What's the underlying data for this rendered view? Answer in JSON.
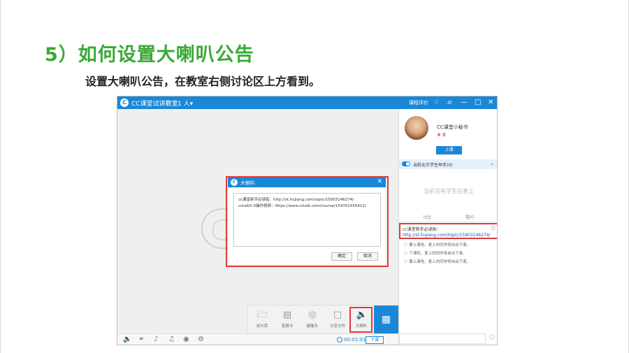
{
  "slide": {
    "title": "5）如何设置大喇叭公告",
    "subtitle": "设置大喇叭公告，在教室右侧讨论区上方看到。"
  },
  "app": {
    "logo": "C",
    "title": "CC课堂试讲教室",
    "people_count": "1 人▾",
    "course_eval": "课程评价",
    "titlebar_icons": [
      "bell-icon",
      "signal-icon",
      "minimize-icon",
      "maximize-icon",
      "close-icon"
    ],
    "user": {
      "name": "CC课堂小秘书",
      "score": "0",
      "stage_button": "上课"
    },
    "allow_hands": "当前允许学生举手(0)",
    "no_students": "当前没有学生在麦上",
    "tabs": [
      "讨论",
      "提问"
    ],
    "notice": {
      "title": "cc课堂新手必读贴：",
      "link": "http://st.hujiang.com/topic/15903146274/"
    },
    "chat_messages": [
      "要上课啦，麦上的同学将自动下麦。",
      "下课啦，麦上的同学将自动下麦。",
      "要上课啦，麦上的同学将自动下麦。"
    ],
    "toolbar": [
      {
        "label": "讲义库",
        "icon": "folder-icon"
      },
      {
        "label": "答题卡",
        "icon": "clipboard-icon"
      },
      {
        "label": "摄像头",
        "icon": "camera-icon"
      },
      {
        "label": "分享文件",
        "icon": "file-icon"
      },
      {
        "label": "大喇叭",
        "icon": "speaker-icon"
      }
    ],
    "bottom_icons": [
      "volume-icon",
      "mic-icon",
      "music-icon",
      "note-icon",
      "record-icon",
      "settings-icon"
    ],
    "timer": "00:01:01",
    "end_button": "下课"
  },
  "dialog": {
    "logo": "C",
    "title": "大喇叭",
    "line1": "cc课堂新手必读贴：http://st.hujiang.com/topic/15903146274/",
    "line2": "cctalk5.0操作视频：https://www.cctalk.com/course/154761555412/",
    "confirm": "确定",
    "cancel": "取消"
  }
}
